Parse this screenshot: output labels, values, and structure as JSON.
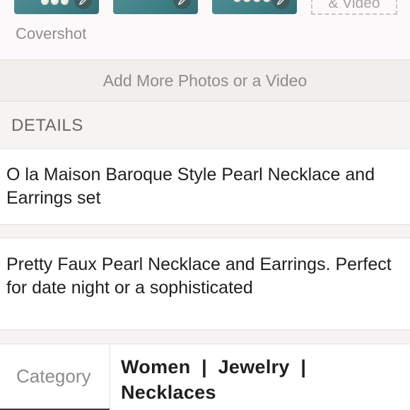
{
  "photos": {
    "thumbnails": [
      {
        "edit_icon": "pencil-icon"
      },
      {
        "edit_icon": "pencil-icon"
      },
      {
        "edit_icon": "pencil-icon"
      }
    ],
    "add_video_label": "& Video",
    "covershot_label": "Covershot"
  },
  "add_more_label": "Add More Photos or a Video",
  "details": {
    "header": "DETAILS",
    "title": "O la Maison Baroque Style Pearl Necklace and Earrings set",
    "description": "Pretty Faux Pearl Necklace and Earrings. Perfect for date night or a sophisticated",
    "category_label": "Category",
    "category_value": "Women  |  Jewelry  |  Necklaces"
  },
  "colors": {
    "thumbnail_bg": "#4f8d95",
    "muted_text": "#8e8b8a",
    "section_bg": "#f6f4f3"
  }
}
